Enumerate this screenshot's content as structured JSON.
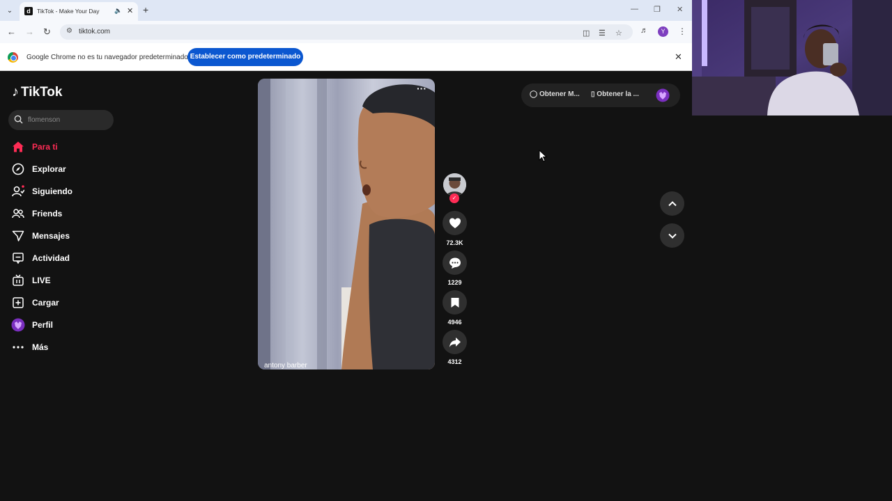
{
  "browser": {
    "tab_title": "TikTok - Make Your Day",
    "favicon_letter": "d",
    "url": "tiktok.com",
    "profile_initial": "Y",
    "infobar": {
      "message": "Google Chrome no es tu navegador predeterminado",
      "button_label": "Establecer como predeterminado"
    }
  },
  "tiktok": {
    "logo_text": "TikTok",
    "search_placeholder": "flomenson",
    "nav": [
      {
        "label": "Para ti",
        "icon": "home-icon",
        "active": true
      },
      {
        "label": "Explorar",
        "icon": "compass-icon"
      },
      {
        "label": "Siguiendo",
        "icon": "following-icon"
      },
      {
        "label": "Friends",
        "icon": "friends-icon"
      },
      {
        "label": "Mensajes",
        "icon": "messages-icon"
      },
      {
        "label": "Actividad",
        "icon": "activity-icon"
      },
      {
        "label": "LIVE",
        "icon": "live-icon"
      },
      {
        "label": "Cargar",
        "icon": "upload-icon"
      },
      {
        "label": "Perfil",
        "icon": "profile-icon"
      },
      {
        "label": "Más",
        "icon": "more-icon"
      }
    ],
    "video": {
      "author": "antony barber",
      "more_glyph": "···"
    },
    "actions": {
      "likes": "72.3K",
      "comments": "1229",
      "saves": "4946",
      "shares": "4312"
    },
    "get_pill": {
      "item1": "Obtener M...",
      "item2": "Obtener la ..."
    },
    "colors": {
      "accent": "#fe2c55",
      "background": "#121212",
      "chrome_button": "#0b57d0"
    }
  }
}
